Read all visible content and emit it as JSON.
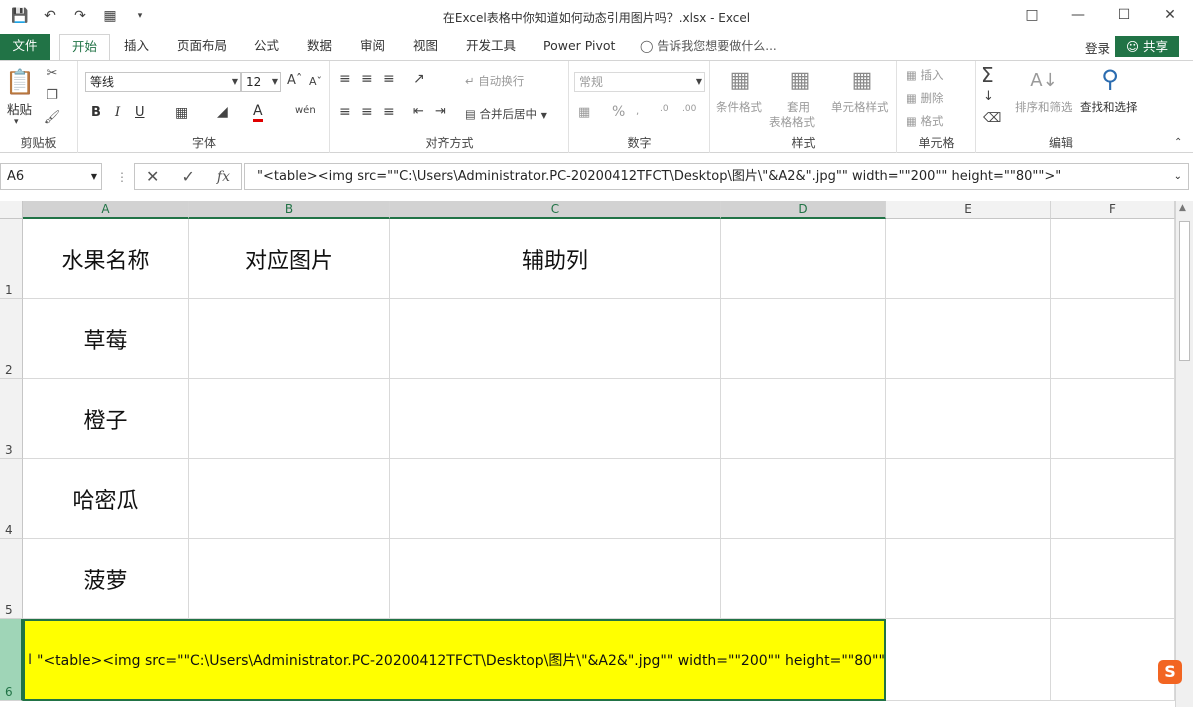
{
  "window": {
    "title": "在Excel表格中你知道如何动态引用图片吗？.xlsx - Excel"
  },
  "tabs": {
    "file": "文件",
    "items": [
      "开始",
      "插入",
      "页面布局",
      "公式",
      "数据",
      "审阅",
      "视图",
      "开发工具",
      "Power Pivot"
    ],
    "tell_me": "告诉我您想要做什么...",
    "login": "登录",
    "share": "共享"
  },
  "ribbon": {
    "clipboard": {
      "paste": "粘贴",
      "label": "剪贴板"
    },
    "font": {
      "name": "等线",
      "size": "12",
      "bold": "B",
      "italic": "I",
      "underline": "U",
      "label": "字体"
    },
    "alignment": {
      "wrap": "自动换行",
      "merge": "合并后居中",
      "label": "对齐方式"
    },
    "number": {
      "format": "常规",
      "percent": "%",
      "label": "数字"
    },
    "styles": {
      "conditional": "条件格式",
      "table_line1": "套用",
      "table_line2": "表格格式",
      "cell_styles": "单元格样式",
      "label": "样式"
    },
    "cells": {
      "insert": "插入",
      "delete": "删除",
      "format": "格式",
      "label": "单元格"
    },
    "editing": {
      "sort": "排序和筛选",
      "find": "查找和选择",
      "label": "编辑"
    }
  },
  "formula_bar": {
    "name_box": "A6",
    "formula": "\"<table><img src=\"\"C:\\Users\\Administrator.PC-20200412TFCT\\Desktop\\图片\\\"&A2&\".jpg\"\" width=\"\"200\"\" height=\"\"80\"\">\""
  },
  "sheet": {
    "columns": [
      "A",
      "B",
      "C",
      "D",
      "E",
      "F"
    ],
    "rows": [
      "1",
      "2",
      "3",
      "4",
      "5",
      "6"
    ],
    "cells": {
      "A1": "水果名称",
      "B1": "对应图片",
      "C1": "辅助列",
      "A2": "草莓",
      "A3": "橙子",
      "A4": "哈密瓜",
      "A5": "菠萝",
      "A6": "\"<table><img src=\"\"C:\\Users\\Administrator.PC-20200412TFCT\\Desktop\\图片\\\"&A2&\".jpg\"\" width=\"\"200\"\" height=\"\"80\"\">\""
    },
    "selected_fill": "#ffff00",
    "accent": "#217346"
  }
}
